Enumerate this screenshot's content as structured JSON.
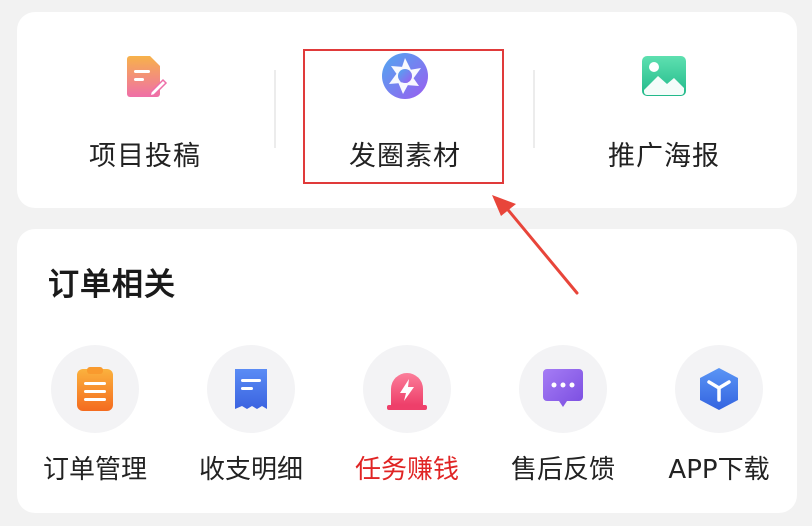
{
  "top_menu": {
    "items": [
      {
        "label": "项目投稿",
        "icon": "document-edit-icon"
      },
      {
        "label": "发圈素材",
        "icon": "aperture-icon"
      },
      {
        "label": "推广海报",
        "icon": "image-icon"
      }
    ]
  },
  "order_section": {
    "title": "订单相关",
    "items": [
      {
        "label": "订单管理",
        "icon": "clipboard-icon"
      },
      {
        "label": "收支明细",
        "icon": "receipt-icon"
      },
      {
        "label": "任务赚钱",
        "icon": "alarm-bolt-icon"
      },
      {
        "label": "售后反馈",
        "icon": "chat-bubble-icon"
      },
      {
        "label": "APP下载",
        "icon": "cube-icon"
      }
    ]
  },
  "colors": {
    "highlight": "#e03a3a",
    "active_label": "#e02424"
  }
}
